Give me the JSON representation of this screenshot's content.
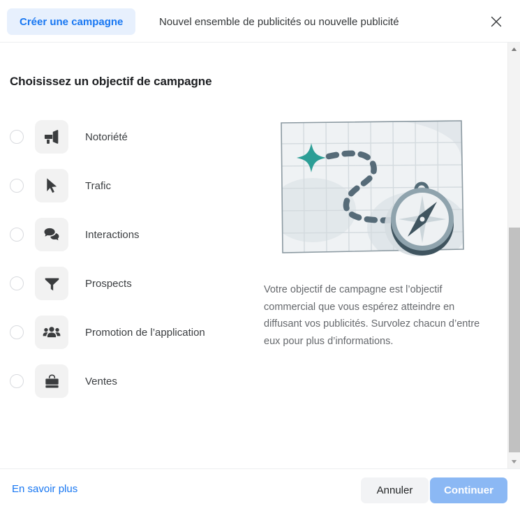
{
  "header": {
    "tab_create_label": "Créer une campagne",
    "tab_new_label": "Nouvel ensemble de publicités ou nouvelle publicité",
    "close_icon": "close-icon",
    "accent_color": "#1877f2",
    "tab_active_bg": "#e7f0fd"
  },
  "main": {
    "title": "Choisissez un objectif de campagne",
    "objectives": [
      {
        "label": "Notoriété",
        "icon": "megaphone-icon",
        "selected": false
      },
      {
        "label": "Trafic",
        "icon": "cursor-arrow-icon",
        "selected": false
      },
      {
        "label": "Interactions",
        "icon": "chat-bubbles-icon",
        "selected": false
      },
      {
        "label": "Prospects",
        "icon": "funnel-icon",
        "selected": false
      },
      {
        "label": "Promotion de l’application",
        "icon": "people-group-icon",
        "selected": false
      },
      {
        "label": "Ventes",
        "icon": "briefcase-icon",
        "selected": false
      }
    ]
  },
  "panel": {
    "illustration_name": "map-with-compass-illustration",
    "description": "Votre objectif de campagne est l’objectif commercial que vous espérez atteindre en diffusant vos publicités. Survolez chacun d’entre eux pour plus d’informations.",
    "illustration_colors": {
      "map_fill": "#eff2f4",
      "grid_line": "#d3dade",
      "star": "#2c9e96",
      "dashed_path": "#566b78",
      "compass_body": "#eef1f3",
      "compass_rim": "#8fa3ad",
      "compass_shadow": "#3f545f"
    }
  },
  "scrollbar": {
    "up_arrow_icon": "scroll-up-arrow-icon",
    "down_arrow_icon": "scroll-down-arrow-icon",
    "thumb_color": "#c1c1c1",
    "track_color": "#f3f3f3"
  },
  "footer": {
    "learn_more_label": "En savoir plus",
    "cancel_label": "Annuler",
    "continue_label": "Continuer",
    "continue_disabled": true,
    "continue_color": "#8bb8f4",
    "cancel_color": "#f2f3f5"
  }
}
